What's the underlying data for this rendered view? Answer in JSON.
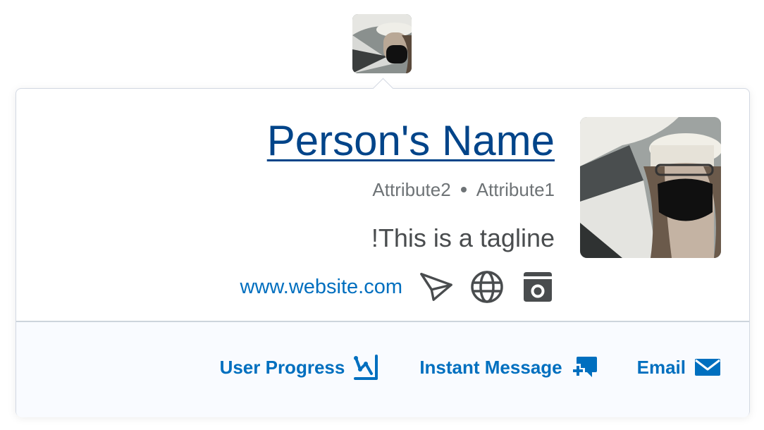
{
  "profile": {
    "name": "Person's Name",
    "attributes": [
      "Attribute2",
      "Attribute1"
    ],
    "tagline": "!This is a tagline",
    "website": "www.website.com",
    "social_icons": [
      "send-icon",
      "globe-icon",
      "save-disk-icon"
    ]
  },
  "actions": {
    "user_progress": "User Progress",
    "instant_message": "Instant Message",
    "email": "Email"
  },
  "colors": {
    "name_link": "#004489",
    "action_blue": "#006fbf",
    "secondary_text": "#6e7376",
    "footer_bg": "#f9fbff"
  }
}
